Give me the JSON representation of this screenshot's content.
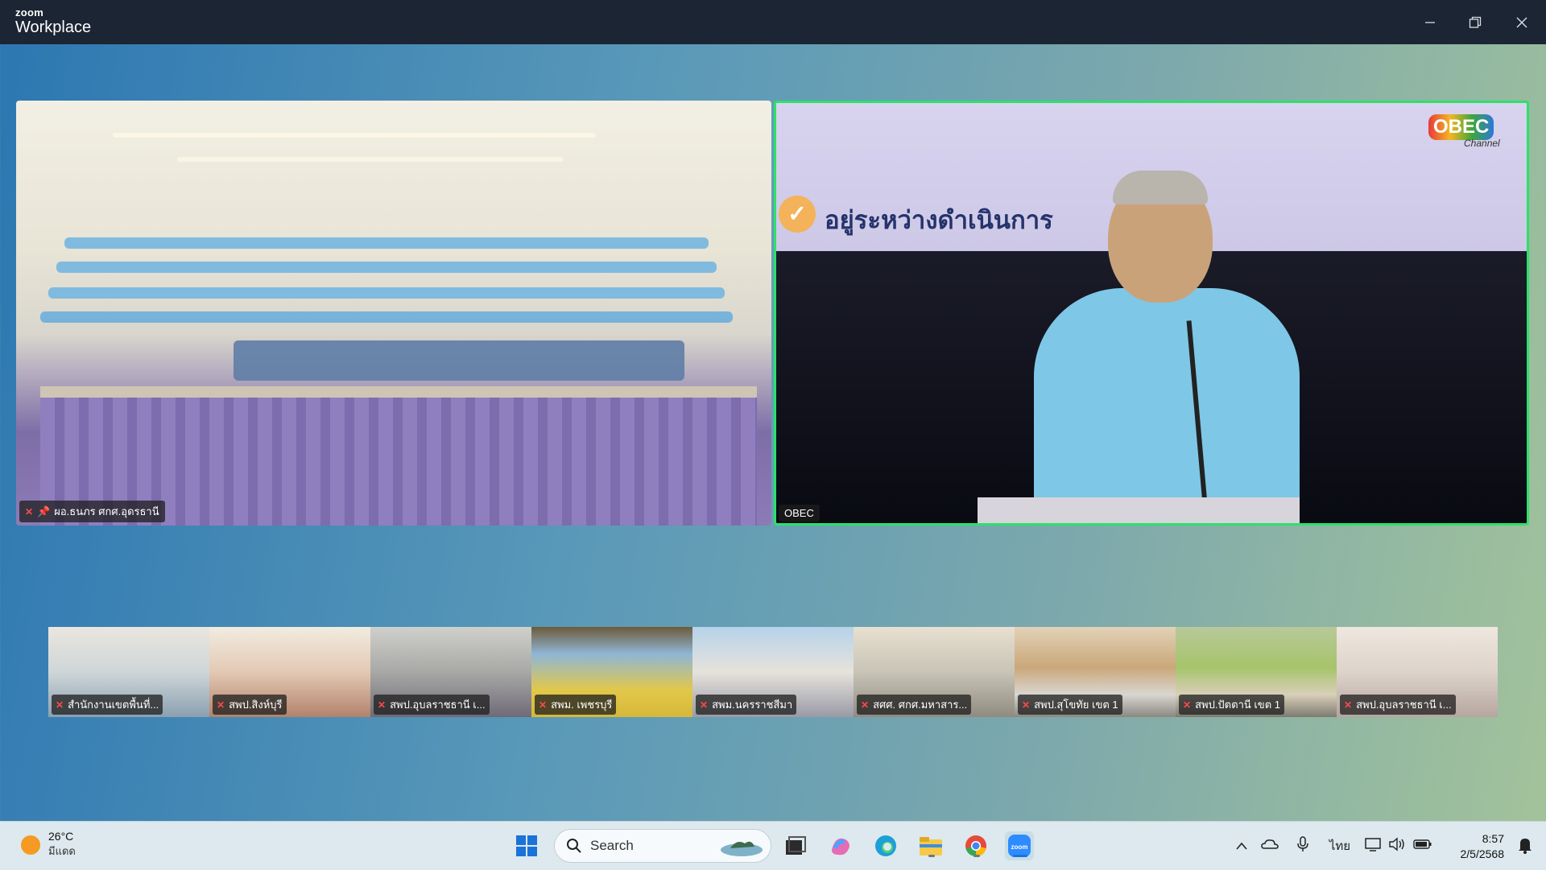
{
  "window": {
    "brand_small": "zoom",
    "brand_big": "Workplace",
    "controls": [
      "minimize-icon",
      "restore-icon",
      "close-icon"
    ]
  },
  "main_tiles": [
    {
      "name": "ผอ.ธนภร ศกศ.อุดรธานี",
      "muted": true,
      "pinned": true
    },
    {
      "name": "OBEC",
      "muted": false,
      "active_speaker": true
    }
  ],
  "slide": {
    "status_text": "อยู่ระหว่างดำเนินการ",
    "logo_text": "OBEC",
    "logo_sub": "Channel"
  },
  "thumbnails": [
    {
      "name": "สำนักงานเขตพื้นที่...",
      "muted": true
    },
    {
      "name": "สพป.สิงห์บุรี",
      "muted": true
    },
    {
      "name": "สพป.อุบลราชธานี เ...",
      "muted": true
    },
    {
      "name": "สพม. เพชรบุรี",
      "muted": true
    },
    {
      "name": "สพม.นครราชสีมา",
      "muted": true
    },
    {
      "name": "สศศ. ศกศ.มหาสาร...",
      "muted": true
    },
    {
      "name": "สพป.สุโขทัย เขต 1",
      "muted": true
    },
    {
      "name": "สพป.ปัตตานี เขต 1",
      "muted": true
    },
    {
      "name": "สพป.อุบลราชธานี เ...",
      "muted": true
    }
  ],
  "taskbar": {
    "weather_temp": "26°C",
    "weather_desc": "มีแดด",
    "search_placeholder": "Search",
    "language": "ไทย",
    "time": "8:57",
    "date": "2/5/2568",
    "apps": [
      "start-icon",
      "search-icon",
      "task-view-icon",
      "copilot-icon",
      "edge-icon",
      "file-explorer-icon",
      "chrome-icon",
      "zoom-icon"
    ],
    "tray": [
      "chevron-up-icon",
      "onedrive-icon",
      "microphone-icon",
      "language-indicator",
      "display-icon",
      "volume-icon",
      "battery-icon",
      "notification-icon"
    ]
  },
  "colors": {
    "titlebar": "#1b2533",
    "active_border": "#2ee06b",
    "muted_red": "#ff4a4a",
    "taskbar": "#dde9ee"
  }
}
